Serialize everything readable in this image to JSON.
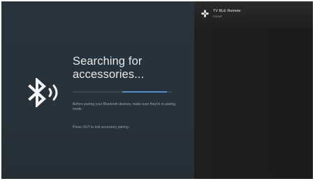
{
  "screen": {
    "title": "Searching for accessories...",
    "description": "Before pairing your Bluetooth devices, make sure they're in pairing mode.",
    "hint": "Press OUT to exit accessory pairing.",
    "progress": 0.45,
    "icon": "bluetooth-searching-icon"
  },
  "device": {
    "name": "TV BLE Remote",
    "status": "Found",
    "icon": "gamepad-icon"
  },
  "colors": {
    "left_panel": "#28323a",
    "right_panel": "#1b1b1b",
    "progress_accent": "#4e8fd1"
  }
}
